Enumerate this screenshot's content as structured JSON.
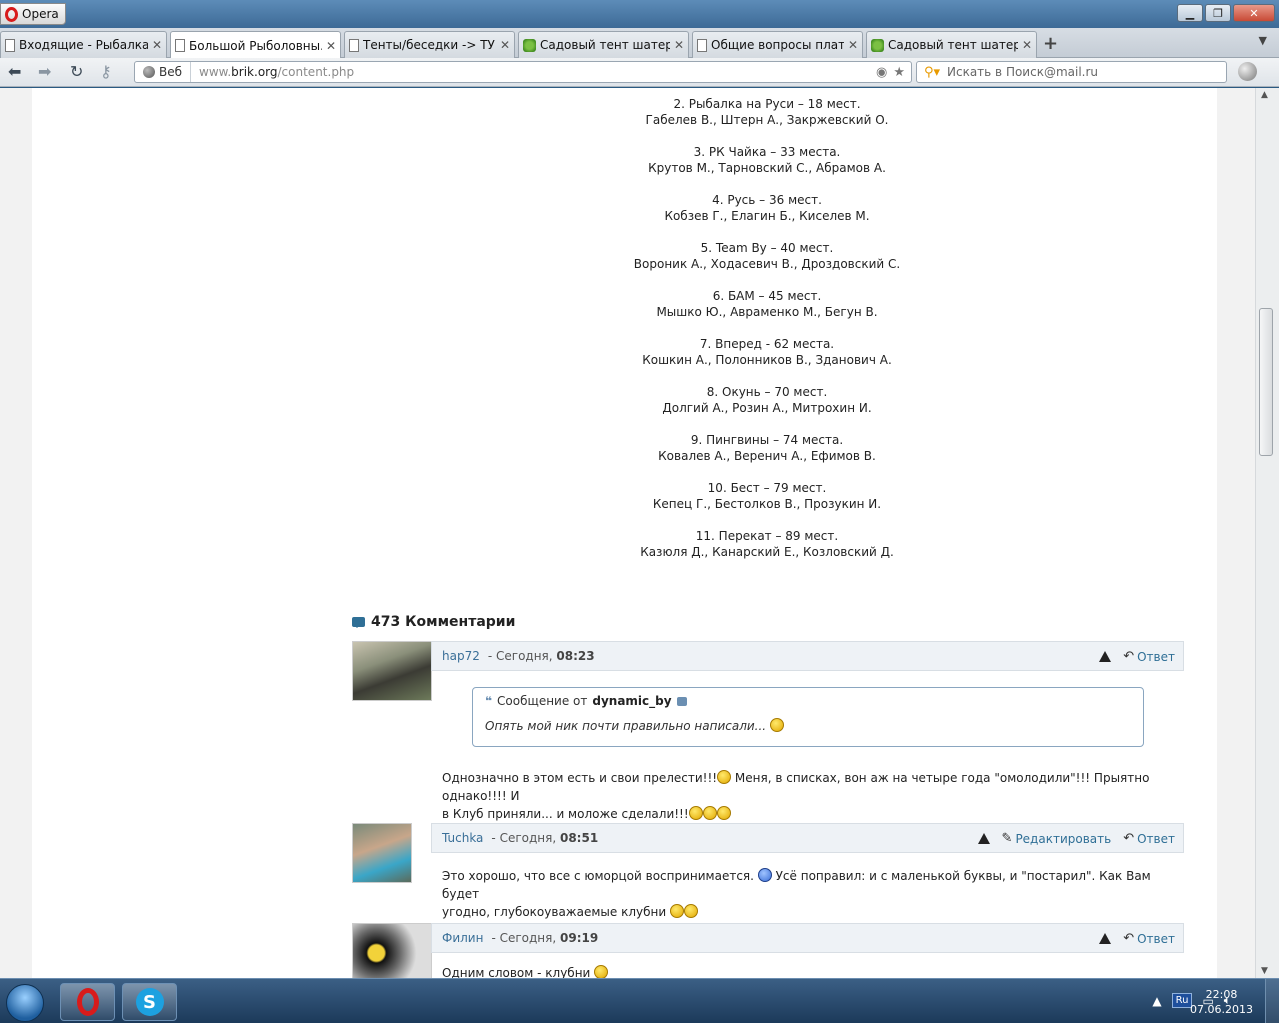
{
  "window": {
    "app_name": "Opera"
  },
  "tabs": [
    {
      "label": "Входящие - Рыбалка в...",
      "icon": "doc",
      "active": false
    },
    {
      "label": "Большой Рыболовны...",
      "icon": "doc",
      "active": true
    },
    {
      "label": "Тенты/беседки -> ТУ...",
      "icon": "doc",
      "active": false
    },
    {
      "label": "Садовый тент шатер ...",
      "icon": "leaf",
      "active": false
    },
    {
      "label": "Общие вопросы плат...",
      "icon": "doc",
      "active": false
    },
    {
      "label": "Садовый тент шатер ...",
      "icon": "leaf",
      "active": false
    }
  ],
  "addressbar": {
    "web_label": "Веб",
    "url_prefix": "www.",
    "url_domain": "brik.org",
    "url_path": "/content.php",
    "search_placeholder": "Искать в Поиск@mail.ru"
  },
  "results": [
    {
      "team": "2. Рыбалка на Руси – 18 мест.",
      "members": "Габелев В., Штерн А., Закржевский О."
    },
    {
      "team": "3. РК Чайка – 33 места.",
      "members": "Крутов М., Тарновский С., Абрамов А."
    },
    {
      "team": "4. Русь – 36 мест.",
      "members": "Кобзев Г., Елагин Б., Киселев М."
    },
    {
      "team": "5. Team By – 40 мест.",
      "members": "Вороник А., Ходасевич В., Дроздовский С."
    },
    {
      "team": "6. БАМ – 45 мест.",
      "members": "Мышко Ю., Авраменко М., Бегун В."
    },
    {
      "team": "7. Вперед - 62 места.",
      "members": "Кошкин А., Полонников В., Зданович А."
    },
    {
      "team": "8. Окунь – 70 мест.",
      "members": "Долгий А., Розин А., Митрохин И."
    },
    {
      "team": "9. Пингвины – 74 места.",
      "members": "Ковалев А., Веренич А., Ефимов В."
    },
    {
      "team": "10. Бест – 79 мест.",
      "members": "Кепец Г., Бестолков В., Прозукин И."
    },
    {
      "team": "11. Перекат – 89 мест.",
      "members": "Казюля Д., Канарский Е., Козловский Д."
    }
  ],
  "comments": {
    "title": "473 Комментарии",
    "items": [
      {
        "author": "hap72",
        "date_sep": " - Сегодня, ",
        "time": "08:23",
        "reply": "Ответ",
        "quote_prefix": "Сообщение от",
        "quote_author": "dynamic_by",
        "quote_text": "Опять мой ник почти правильно написали...",
        "text1": "Однозначно в этом есть и свои прелести!!!",
        "text2": " Меня, в списках, вон аж на четыре года \"омолодили\"!!! Прыятно однако!!!! И",
        "text3": "в Клуб приняли... и моложе сделали!!!"
      },
      {
        "author": "Tuchka",
        "date_sep": " - Сегодня, ",
        "time": "08:51",
        "edit": "Редактировать",
        "reply": "Ответ",
        "text1": "Это хорошо, что все с юморцой воспринимается.",
        "text2": " Усё поправил: и с маленькой буквы, и \"постарил\". Как Вам будет",
        "text3": "угодно, глубокоуважаемые клубни"
      },
      {
        "author": "Филин",
        "date_sep": " - Сегодня, ",
        "time": "09:19",
        "reply": "Ответ",
        "text1": "Одним словом - клубни"
      }
    ]
  },
  "taskbar": {
    "lang": "Ru",
    "time": "22:08",
    "date": "07.06.2013"
  }
}
